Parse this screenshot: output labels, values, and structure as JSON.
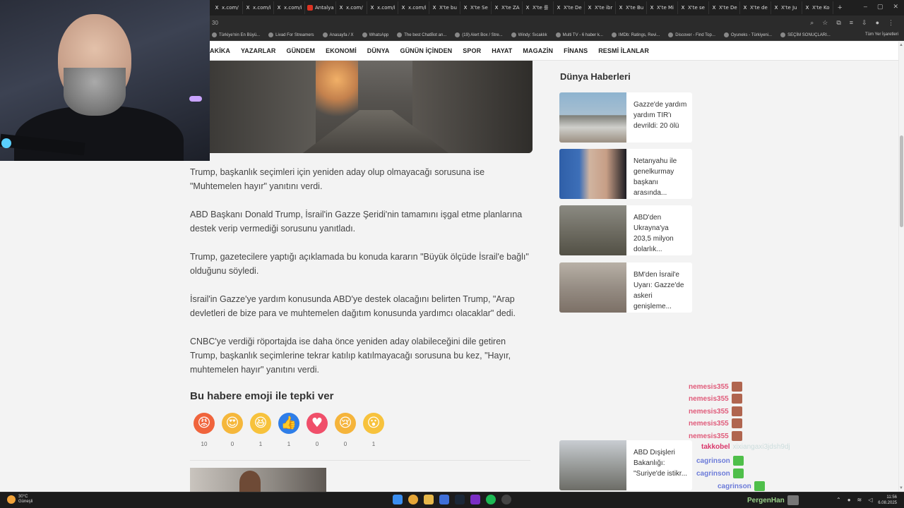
{
  "browser": {
    "tabs": [
      {
        "icon": "x-icon",
        "label": "x.com/"
      },
      {
        "icon": "x-icon",
        "label": "x.com/i"
      },
      {
        "icon": "x-icon",
        "label": "x.com/i"
      },
      {
        "icon": "news-icon",
        "label": "Antalya"
      },
      {
        "icon": "x-icon",
        "label": "x.com/"
      },
      {
        "icon": "x-icon",
        "label": "x.com/i"
      },
      {
        "icon": "x-icon",
        "label": "x.com/i"
      },
      {
        "icon": "x-icon",
        "label": "X'te bu"
      },
      {
        "icon": "x-icon",
        "label": "X'te Se"
      },
      {
        "icon": "x-icon",
        "label": "X'te ZA"
      },
      {
        "icon": "x-icon",
        "label": "X'te 를"
      },
      {
        "icon": "x-icon",
        "label": "X'te De"
      },
      {
        "icon": "x-icon",
        "label": "X'te ibr"
      },
      {
        "icon": "x-icon",
        "label": "X'te Bu"
      },
      {
        "icon": "x-icon",
        "label": "X'te Mi"
      },
      {
        "icon": "x-icon",
        "label": "X'te se"
      },
      {
        "icon": "x-icon",
        "label": "X'te De"
      },
      {
        "icon": "x-icon",
        "label": "X'te de"
      },
      {
        "icon": "x-icon",
        "label": "X'te Ju"
      },
      {
        "icon": "x-icon",
        "label": "X'te Ko"
      }
    ],
    "url": "30",
    "bookmarks": [
      "Türkiye'nin En Büyü...",
      "Livad For Streamers",
      "Anasayfa / X",
      "WhatsApp",
      "The best ChatBot an...",
      "(19) Alert Box / Stre...",
      "Windy: Sıcaklık",
      "Multi TV - 6 haber k...",
      "IMDb: Ratings, Revi...",
      "Discover - Find Top...",
      "Oyuneks - Türkiyeni...",
      "SEÇİM SONUÇLARI..."
    ],
    "bookmarks_right": "Tüm Yer İşaretleri"
  },
  "site_nav": [
    "AKİKA",
    "YAZARLAR",
    "GÜNDEM",
    "EKONOMİ",
    "DÜNYA",
    "GÜNÜN İÇİNDEN",
    "SPOR",
    "HAYAT",
    "MAGAZİN",
    "FİNANS",
    "RESMİ İLANLAR"
  ],
  "article": {
    "paragraphs": [
      "Trump, başkanlık seçimleri için yeniden aday olup olmayacağı sorusuna ise \"Muhtemelen hayır\" yanıtını verdi.",
      "ABD Başkanı Donald Trump, İsrail'in Gazze Şeridi'nin tamamını işgal etme planlarına destek verip vermediği sorusunu yanıtladı.",
      "Trump, gazetecilere yaptığı açıklamada bu konuda kararın \"Büyük ölçüde İsrail'e bağlı\" olduğunu söyledi.",
      "İsrail'in Gazze'ye yardım konusunda ABD'ye destek olacağını belirten Trump, \"Arap devletleri de bize para ve muhtemelen dağıtım konusunda yardımcı olacaklar\" dedi.",
      "CNBC'ye verdiği röportajda ise daha önce yeniden aday olabileceğini dile getiren Trump, başkanlık seçimlerine tekrar katılıp katılmayacağı sorusuna bu kez, \"Hayır, muhtemelen hayır\" yanıtını verdi."
    ],
    "reaction_title": "Bu habere emoji ile tepki ver",
    "reactions": [
      {
        "name": "angry",
        "glyph": "😡",
        "color": "#f0643c",
        "count": "10"
      },
      {
        "name": "love-eyes",
        "glyph": "😍",
        "color": "#f5b73b",
        "count": "0"
      },
      {
        "name": "laugh",
        "glyph": "😆",
        "color": "#f7c23c",
        "count": "1"
      },
      {
        "name": "like",
        "glyph": "👍",
        "color": "#2f7ee8",
        "count": "1"
      },
      {
        "name": "heart",
        "glyph": "♥",
        "color": "#f04f6a",
        "count": "0"
      },
      {
        "name": "sad",
        "glyph": "😢",
        "color": "#f5b43b",
        "count": "0"
      },
      {
        "name": "wow",
        "glyph": "😮",
        "color": "#f7c23c",
        "count": "1"
      }
    ]
  },
  "sidebar": {
    "title": "Dünya Haberleri",
    "items": [
      {
        "caption": "Gazze'de yardım yardım TIR'ı devrildi: 20 ölü",
        "img": "linear-gradient(180deg,#8eb3cf 0%,#a7bfd1 45%,#7d7e78 46%,#cfcfcb 70%,#9b8f82 100%)"
      },
      {
        "caption": "Netanyahu ile genelkurmay başkanı arasında...",
        "img": "linear-gradient(90deg,#2f5fa8 0%,#3d6fb8 30%,#d0b4a0 45%,#c79e86 70%,#1c1c22 100%)"
      },
      {
        "caption": "ABD'den Ukrayna'ya 203,5 milyon dolarlık...",
        "img": "linear-gradient(180deg,#8b8a82 0%,#6f6d63 50%,#525045 100%)"
      },
      {
        "caption": "BM'den İsrail'e Uyarı: Gazze'de askeri genişleme...",
        "img": "linear-gradient(180deg,#b8b0a6 0%,#968d84 50%,#7c7066 100%)"
      },
      {
        "caption": "ABD Dışişleri Bakanlığı: \"Suriye'de istikr...",
        "img": "linear-gradient(180deg,#c9cdd2 0%,#9ea1a0 45%,#6c6c66 100%)"
      }
    ]
  },
  "chat": [
    {
      "user": "nemesis355",
      "color": "#e05b7a",
      "msg": ""
    },
    {
      "user": "nemesis355",
      "color": "#e05b7a",
      "msg": ""
    },
    {
      "user": "nemesis355",
      "color": "#e05b7a",
      "msg": ""
    },
    {
      "user": "nemesis355",
      "color": "#e05b7a",
      "msg": ""
    },
    {
      "user": "nemesis355",
      "color": "#e05b7a",
      "msg": ""
    },
    {
      "user": "takkobel",
      "color": "#d9366a",
      "msg": "xixiangaxi3jdsh9dj"
    },
    {
      "user": "cagrinson",
      "color": "#6c7bd9",
      "msg": ""
    },
    {
      "user": "cagrinson",
      "color": "#6c7bd9",
      "msg": ""
    },
    {
      "user": "cagrinson",
      "color": "#6c7bd9",
      "msg": ""
    }
  ],
  "taskbar": {
    "weather_temp": "30°C",
    "weather_desc": "Güneşli",
    "streamer": "PergenHan",
    "time": "11:56",
    "date": "6.08.2025"
  }
}
